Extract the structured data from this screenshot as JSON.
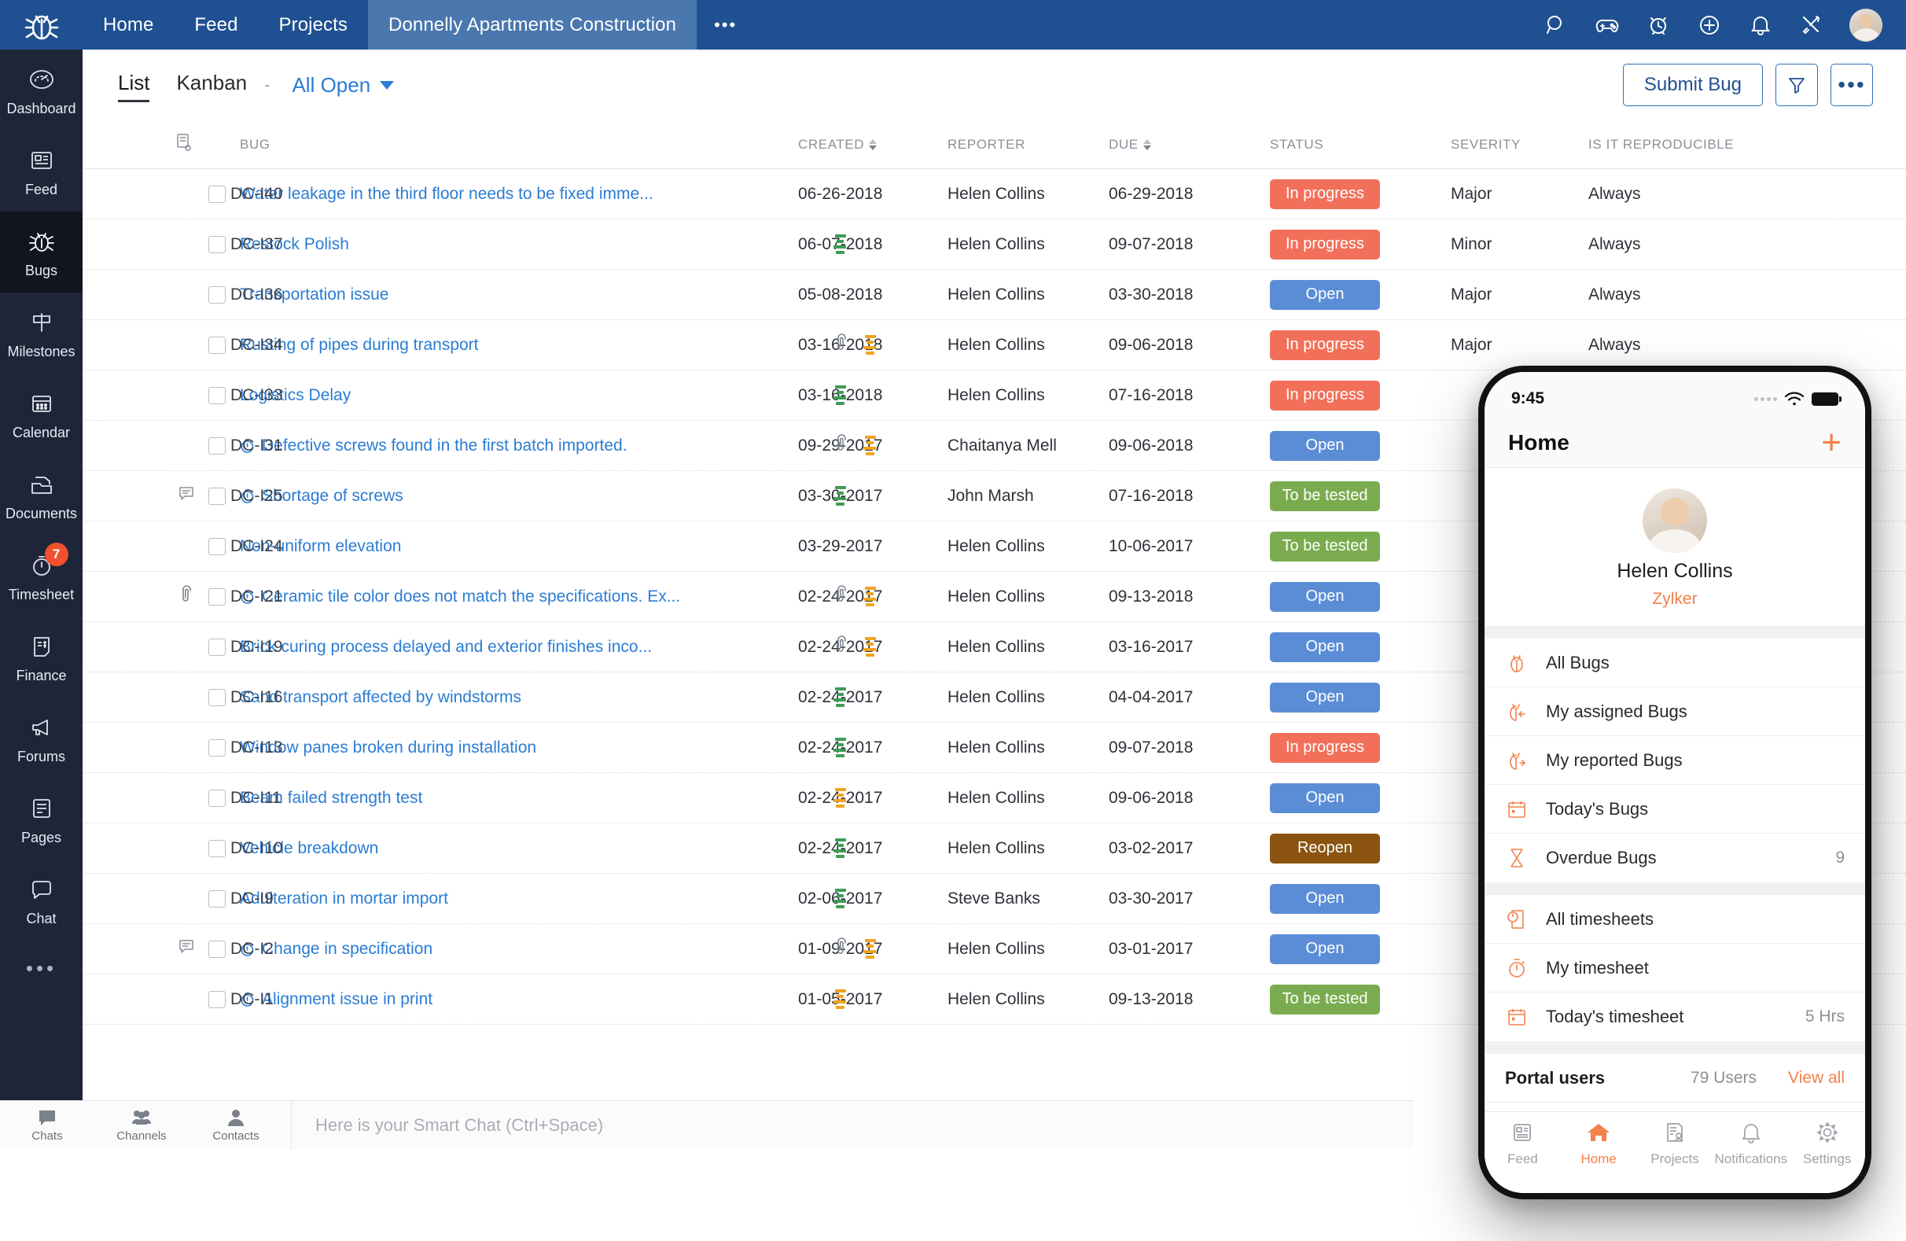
{
  "topbar": {
    "logo": "bug-logo-icon",
    "nav": [
      {
        "label": "Home",
        "active": false
      },
      {
        "label": "Feed",
        "active": false
      },
      {
        "label": "Projects",
        "active": false
      },
      {
        "label": "Donnelly Apartments Construction",
        "active": true
      }
    ],
    "overflow": "•••",
    "icons": [
      "search-icon",
      "gamepad-icon",
      "alarm-clock-icon",
      "plus-circle-icon",
      "bell-icon",
      "tools-icon"
    ],
    "avatar": "user-avatar"
  },
  "sidebar": {
    "items": [
      {
        "label": "Dashboard",
        "icon": "gauge-icon",
        "active": false,
        "badge": ""
      },
      {
        "label": "Feed",
        "icon": "feed-icon",
        "active": false,
        "badge": ""
      },
      {
        "label": "Bugs",
        "icon": "bug-icon",
        "active": true,
        "badge": ""
      },
      {
        "label": "Milestones",
        "icon": "flag-icon",
        "active": false,
        "badge": ""
      },
      {
        "label": "Calendar",
        "icon": "calendar-icon",
        "active": false,
        "badge": ""
      },
      {
        "label": "Documents",
        "icon": "documents-icon",
        "active": false,
        "badge": ""
      },
      {
        "label": "Timesheet",
        "icon": "stopwatch-icon",
        "active": false,
        "badge": "7"
      },
      {
        "label": "Finance",
        "icon": "invoice-icon",
        "active": false,
        "badge": ""
      },
      {
        "label": "Forums",
        "icon": "megaphone-icon",
        "active": false,
        "badge": ""
      },
      {
        "label": "Pages",
        "icon": "pages-icon",
        "active": false,
        "badge": ""
      },
      {
        "label": "Chat",
        "icon": "chat-icon",
        "active": false,
        "badge": ""
      }
    ],
    "more": "•••"
  },
  "subheader": {
    "tabs": [
      {
        "label": "List",
        "active": true
      },
      {
        "label": "Kanban",
        "active": false
      }
    ],
    "separator": "-",
    "filter_label": "All Open",
    "submit_label": "Submit Bug",
    "filter_icon": "funnel-icon",
    "more_icon": "ellipsis-icon"
  },
  "table": {
    "columns": [
      "BUG",
      "CREATED",
      "REPORTER",
      "DUE",
      "STATUS",
      "SEVERITY",
      "IS IT REPRODUCIBLE"
    ],
    "sorted_column": "CREATED",
    "rows": [
      {
        "id": "DC-I40",
        "title": "Water leakage in the third floor needs to be fixed imme...",
        "timer": false,
        "clip": false,
        "priority": "",
        "created": "06-26-2018",
        "reporter": "Helen Collins",
        "due": "06-29-2018",
        "status": "In progress",
        "status_color": "#f2705a",
        "severity": "Major",
        "reproducible": "Always",
        "comment": false,
        "clip_pre": false
      },
      {
        "id": "DC-I37",
        "title": "Restock Polish",
        "timer": false,
        "clip": false,
        "priority": "green",
        "created": "06-07-2018",
        "reporter": "Helen Collins",
        "due": "09-07-2018",
        "status": "In progress",
        "status_color": "#f2705a",
        "severity": "Minor",
        "reproducible": "Always",
        "comment": false,
        "clip_pre": false
      },
      {
        "id": "DC-I36",
        "title": "Transportation issue",
        "timer": false,
        "clip": false,
        "priority": "",
        "created": "05-08-2018",
        "reporter": "Helen Collins",
        "due": "03-30-2018",
        "status": "Open",
        "status_color": "#5b8dd6",
        "severity": "Major",
        "reproducible": "Always",
        "comment": false,
        "clip_pre": false
      },
      {
        "id": "DC-I34",
        "title": "Rusting of pipes during transport",
        "timer": false,
        "clip": true,
        "priority": "orange",
        "created": "03-16-2018",
        "reporter": "Helen Collins",
        "due": "09-06-2018",
        "status": "In progress",
        "status_color": "#f2705a",
        "severity": "Major",
        "reproducible": "Always",
        "comment": false,
        "clip_pre": false
      },
      {
        "id": "DC-I33",
        "title": "Logistics Delay",
        "timer": false,
        "clip": false,
        "priority": "green",
        "created": "03-16-2018",
        "reporter": "Helen Collins",
        "due": "07-16-2018",
        "status": "In progress",
        "status_color": "#f2705a",
        "severity": "",
        "reproducible": "",
        "comment": false,
        "clip_pre": false
      },
      {
        "id": "DC-I31",
        "title": "Defective screws found in the first batch imported.",
        "timer": true,
        "clip": true,
        "priority": "orange",
        "created": "09-29-2017",
        "reporter": "Chaitanya Mell",
        "due": "09-06-2018",
        "status": "Open",
        "status_color": "#5b8dd6",
        "severity": "",
        "reproducible": "",
        "comment": false,
        "clip_pre": false
      },
      {
        "id": "DC-I25",
        "title": "Shortage of screws",
        "timer": true,
        "clip": false,
        "priority": "green",
        "created": "03-30-2017",
        "reporter": "John Marsh",
        "due": "07-16-2018",
        "status": "To be tested",
        "status_color": "#7aac4f",
        "severity": "",
        "reproducible": "",
        "comment": true,
        "clip_pre": false
      },
      {
        "id": "DC-I24",
        "title": "Non-uniform elevation",
        "timer": false,
        "clip": false,
        "priority": "",
        "created": "03-29-2017",
        "reporter": "Helen Collins",
        "due": "10-06-2017",
        "status": "To be tested",
        "status_color": "#7aac4f",
        "severity": "",
        "reproducible": "",
        "comment": false,
        "clip_pre": false
      },
      {
        "id": "DC-I21",
        "title": "Ceramic tile color does not match the specifications. Ex...",
        "timer": true,
        "clip": true,
        "priority": "orange",
        "created": "02-24-2017",
        "reporter": "Helen Collins",
        "due": "09-13-2018",
        "status": "Open",
        "status_color": "#5b8dd6",
        "severity": "",
        "reproducible": "",
        "comment": false,
        "clip_pre": true
      },
      {
        "id": "DC-I19",
        "title": "Brick curing process delayed and exterior finishes inco...",
        "timer": false,
        "clip": true,
        "priority": "orange",
        "created": "02-24-2017",
        "reporter": "Helen Collins",
        "due": "03-16-2017",
        "status": "Open",
        "status_color": "#5b8dd6",
        "severity": "",
        "reproducible": "",
        "comment": false,
        "clip_pre": false
      },
      {
        "id": "DC-I16",
        "title": "Sand transport affected by windstorms",
        "timer": false,
        "clip": false,
        "priority": "green",
        "created": "02-24-2017",
        "reporter": "Helen Collins",
        "due": "04-04-2017",
        "status": "Open",
        "status_color": "#5b8dd6",
        "severity": "",
        "reproducible": "",
        "comment": false,
        "clip_pre": false
      },
      {
        "id": "DC-I13",
        "title": "Window panes broken during installation",
        "timer": false,
        "clip": false,
        "priority": "green",
        "created": "02-24-2017",
        "reporter": "Helen Collins",
        "due": "09-07-2018",
        "status": "In progress",
        "status_color": "#f2705a",
        "severity": "",
        "reproducible": "",
        "comment": false,
        "clip_pre": false
      },
      {
        "id": "DC-I11",
        "title": "Beam failed strength test",
        "timer": false,
        "clip": false,
        "priority": "orange",
        "created": "02-24-2017",
        "reporter": "Helen Collins",
        "due": "09-06-2018",
        "status": "Open",
        "status_color": "#5b8dd6",
        "severity": "",
        "reproducible": "",
        "comment": false,
        "clip_pre": false
      },
      {
        "id": "DC-I10",
        "title": "Vehicle breakdown",
        "timer": false,
        "clip": false,
        "priority": "green",
        "created": "02-24-2017",
        "reporter": "Helen Collins",
        "due": "03-02-2017",
        "status": "Reopen",
        "status_color": "#8a5410",
        "severity": "",
        "reproducible": "",
        "comment": false,
        "clip_pre": false
      },
      {
        "id": "DC-I9",
        "title": "Adulteration in mortar import",
        "timer": false,
        "clip": false,
        "priority": "green",
        "created": "02-06-2017",
        "reporter": "Steve Banks",
        "due": "03-30-2017",
        "status": "Open",
        "status_color": "#5b8dd6",
        "severity": "",
        "reproducible": "",
        "comment": false,
        "clip_pre": false
      },
      {
        "id": "DC-I2",
        "title": "Change in specification",
        "timer": true,
        "clip": true,
        "priority": "orange",
        "created": "01-09-2017",
        "reporter": "Helen Collins",
        "due": "03-01-2017",
        "status": "Open",
        "status_color": "#5b8dd6",
        "severity": "",
        "reproducible": "",
        "comment": true,
        "clip_pre": false
      },
      {
        "id": "DC-I1",
        "title": "Alignment issue in print",
        "timer": true,
        "clip": false,
        "priority": "orange",
        "created": "01-05-2017",
        "reporter": "Helen Collins",
        "due": "09-13-2018",
        "status": "To be tested",
        "status_color": "#7aac4f",
        "severity": "",
        "reproducible": "",
        "comment": false,
        "clip_pre": false
      }
    ]
  },
  "chatbar": {
    "tiles": [
      {
        "label": "Chats",
        "icon": "chat-bubble-icon"
      },
      {
        "label": "Channels",
        "icon": "group-icon"
      },
      {
        "label": "Contacts",
        "icon": "person-icon"
      }
    ],
    "placeholder": "Here is your Smart Chat (Ctrl+Space)"
  },
  "phone": {
    "status": {
      "time": "9:45",
      "wifi": "wifi-icon",
      "battery": "battery-icon"
    },
    "navbar": {
      "title": "Home",
      "add": "+"
    },
    "profile": {
      "name": "Helen Collins",
      "org": "Zylker"
    },
    "bugs_group": [
      {
        "label": "All Bugs",
        "icon": "bug-icon",
        "value": ""
      },
      {
        "label": "My assigned Bugs",
        "icon": "bug-assigned-icon",
        "value": ""
      },
      {
        "label": "My reported Bugs",
        "icon": "bug-reported-icon",
        "value": ""
      },
      {
        "label": "Today's Bugs",
        "icon": "calendar-icon",
        "value": ""
      },
      {
        "label": "Overdue Bugs",
        "icon": "hourglass-icon",
        "value": "9"
      }
    ],
    "timesheet_group": [
      {
        "label": "All timesheets",
        "icon": "timesheet-icon",
        "value": ""
      },
      {
        "label": "My timesheet",
        "icon": "stopwatch-icon",
        "value": ""
      },
      {
        "label": "Today's timesheet",
        "icon": "calendar-icon",
        "value": "5 Hrs"
      }
    ],
    "portal": {
      "title": "Portal users",
      "count": "79 Users",
      "link": "View all"
    },
    "tabbar": [
      {
        "label": "Feed",
        "icon": "feed-icon",
        "active": false
      },
      {
        "label": "Home",
        "icon": "home-icon",
        "active": true
      },
      {
        "label": "Projects",
        "icon": "projects-icon",
        "active": false
      },
      {
        "label": "Notifications",
        "icon": "bell-icon",
        "active": false
      },
      {
        "label": "Settings",
        "icon": "gear-icon",
        "active": false
      }
    ]
  },
  "colors": {
    "header_blue": "#1f5091",
    "sidebar_navy": "#1e2539",
    "accent_orange": "#f2814b",
    "link_blue": "#2b7cd3",
    "status_inprogress": "#f2705a",
    "status_open": "#5b8dd6",
    "status_tobetested": "#7aac4f",
    "status_reopen": "#8a5410"
  }
}
